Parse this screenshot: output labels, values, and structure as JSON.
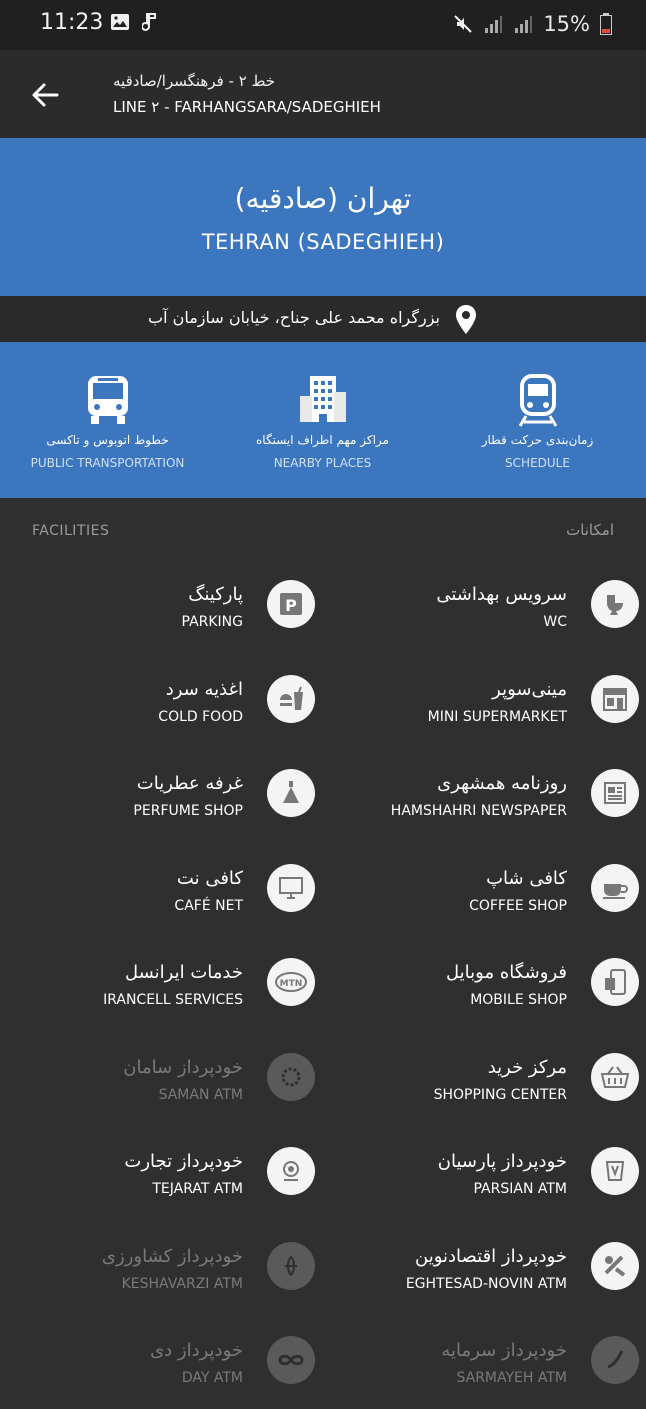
{
  "status": {
    "time": "11:23",
    "battery": "15%"
  },
  "header": {
    "line_fa": "خط ۲ - فرهنگسرا/صادقیه",
    "line_en": "LINE ۲ - FARHANGSARA/SADEGHIEH"
  },
  "station": {
    "name_fa": "تهران (صادقیه)",
    "name_en": "TEHRAN (SADEGHIEH)",
    "address": "بزرگراه محمد علی جناح، خیابان سازمان آب"
  },
  "actions": [
    {
      "fa": "خطوط اتوبوس و تاکسی",
      "en": "PUBLIC TRANSPORTATION",
      "icon": "bus-icon"
    },
    {
      "fa": "مراکز مهم اطراف ایستگاه",
      "en": "NEARBY PLACES",
      "icon": "building-icon"
    },
    {
      "fa": "زمان‌بندی حرکت قطار",
      "en": "SCHEDULE",
      "icon": "train-icon"
    }
  ],
  "facilities": {
    "title_en": "FACILITIES",
    "title_fa": "امکانات",
    "right": [
      {
        "fa": "سرویس بهداشتی",
        "en": "WC",
        "icon": "toilet-icon"
      },
      {
        "fa": "مینی‌سوپر",
        "en": "MINI SUPERMARKET",
        "icon": "store-icon"
      },
      {
        "fa": "روزنامه همشهری",
        "en": "HAMSHAHRI NEWSPAPER",
        "icon": "newspaper-icon"
      },
      {
        "fa": "کافی شاپ",
        "en": "COFFEE SHOP",
        "icon": "coffee-icon"
      },
      {
        "fa": "فروشگاه موبایل",
        "en": "MOBILE SHOP",
        "icon": "mobile-icon"
      },
      {
        "fa": "مرکز خرید",
        "en": "SHOPPING CENTER",
        "icon": "basket-icon"
      },
      {
        "fa": "خودپرداز پارسیان",
        "en": "PARSIAN ATM",
        "icon": "parsian-icon"
      },
      {
        "fa": "خودپرداز اقتصادنوین",
        "en": "EGHTESAD-NOVIN ATM",
        "icon": "eghtesad-icon"
      },
      {
        "fa": "خودپرداز سرمایه",
        "en": "SARMAYEH ATM",
        "icon": "sarmayeh-icon",
        "dim": true
      }
    ],
    "left": [
      {
        "fa": "پارکینگ",
        "en": "PARKING",
        "icon": "parking-icon"
      },
      {
        "fa": "اغذیه سرد",
        "en": "COLD FOOD",
        "icon": "food-icon"
      },
      {
        "fa": "غرفه عطریات",
        "en": "PERFUME SHOP",
        "icon": "perfume-icon"
      },
      {
        "fa": "کافی نت",
        "en": "CAFÉ NET",
        "icon": "computer-icon"
      },
      {
        "fa": "خدمات ایرانسل",
        "en": "IRANCELL SERVICES",
        "icon": "mtn-icon"
      },
      {
        "fa": "خودپرداز سامان",
        "en": "SAMAN ATM",
        "icon": "saman-icon",
        "dim": true
      },
      {
        "fa": "خودپرداز تجارت",
        "en": "TEJARAT ATM",
        "icon": "tejarat-icon"
      },
      {
        "fa": "خودپرداز کشاورزی",
        "en": "KESHAVARZI ATM",
        "icon": "keshavarzi-icon",
        "dim": true
      },
      {
        "fa": "خودپرداز دی",
        "en": "DAY ATM",
        "icon": "day-icon",
        "dim": true
      }
    ]
  }
}
